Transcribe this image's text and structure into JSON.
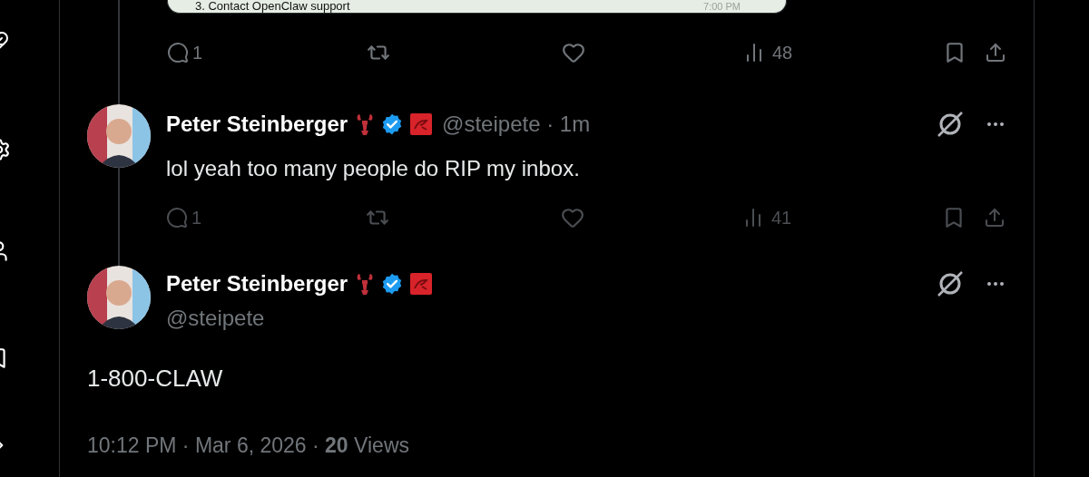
{
  "embedded_card": {
    "text": "3. Contact OpenClaw support",
    "time": "7:00 PM"
  },
  "previous_tweet_actions": {
    "replies": "1",
    "views": "48"
  },
  "reply": {
    "name": "Peter Steinberger",
    "handle": "@steipete · 1m",
    "text": "lol yeah too many people do RIP my inbox.",
    "actions": {
      "replies": "1",
      "views": "41"
    }
  },
  "main_tweet": {
    "name": "Peter Steinberger",
    "handle": "@steipete",
    "text": "1-800-CLAW",
    "footer": "10:12 PM · Mar 6, 2026 · **20** Views"
  }
}
